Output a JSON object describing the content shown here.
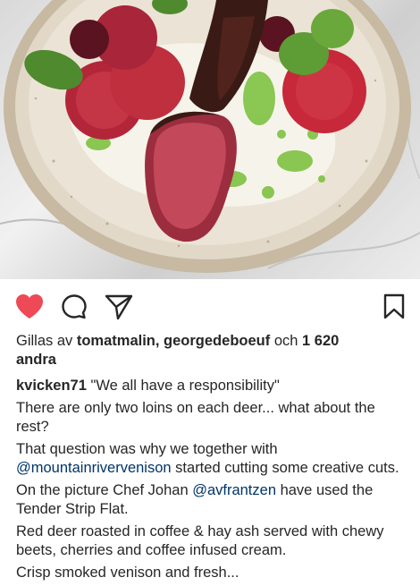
{
  "post": {
    "image_alt_name": "plated-venison-dish"
  },
  "actions": {
    "like_icon": "heart-icon-filled",
    "comment_icon": "comment-icon",
    "share_icon": "direct-share-icon",
    "save_icon": "bookmark-icon",
    "like_color": "#ed4956"
  },
  "likes": {
    "prefix": "Gillas av ",
    "user1": "tomatmalin",
    "sep": ", ",
    "user2": "georgedeboeuf",
    "mid": " och ",
    "count": "1 620",
    "suffix": "andra"
  },
  "caption": {
    "username": "kvicken71",
    "line1": " \"We all have a responsibility\"",
    "p1": "There are only two loins on each deer... what about the rest?",
    "p2_a": "That question was why we together with ",
    "p2_mention": "@mountainrivervenison",
    "p2_b": " started cutting some creative cuts.",
    "p3_a": "On the picture Chef Johan ",
    "p3_mention": "@avfrantzen",
    "p3_b": " have used the Tender Strip Flat.",
    "p4": "Red deer roasted in coffee & hay ash served with chewy beets, cherries and coffee infused cream.",
    "p5": "Crisp smoked venison and fresh..."
  }
}
